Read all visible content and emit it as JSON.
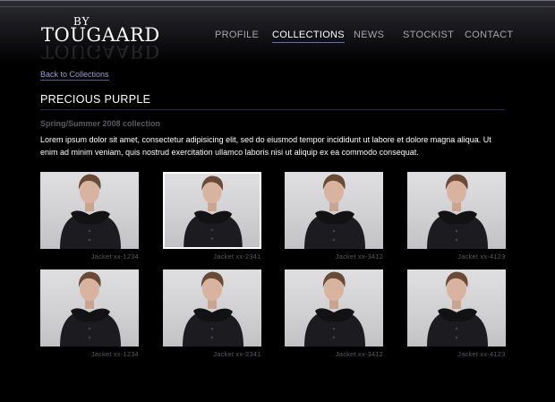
{
  "brand": {
    "by": "BY",
    "name": "TOUGAARD"
  },
  "nav": [
    {
      "label": "PROFILE",
      "active": false
    },
    {
      "label": "COLLECTIONS",
      "active": true
    },
    {
      "label": "NEWS",
      "active": false
    },
    {
      "label": "STOCKIST",
      "active": false
    },
    {
      "label": "CONTACT",
      "active": false
    }
  ],
  "back_link": "Back to Collections",
  "collection": {
    "title": "PRECIOUS PURPLE",
    "season": "Spring/Summer 2008 collection",
    "description": "Lorem ipsum dolor sit amet, consectetur adipisicing elit, sed do eiusmod tempor incididunt ut labore et dolore magna aliqua. Ut enim ad minim veniam, quis nostrud exercitation ullamco laboris nisi ut aliquip ex ea commodo consequat."
  },
  "items": [
    {
      "caption": "Jacket xx-1234",
      "selected": false
    },
    {
      "caption": "Jacket xx-2341",
      "selected": true
    },
    {
      "caption": "Jacket xx-3412",
      "selected": false
    },
    {
      "caption": "Jacket xx-4123",
      "selected": false
    },
    {
      "caption": "Jacket xx-1234",
      "selected": false
    },
    {
      "caption": "Jacket xx-2341",
      "selected": false
    },
    {
      "caption": "Jacket xx-3412",
      "selected": false
    },
    {
      "caption": "Jacket xx-4123",
      "selected": false
    }
  ],
  "colors": {
    "background": "#000000",
    "nav_active_underline": "#6c6cbf",
    "link": "#9c9cd8",
    "caption": "#58585f"
  }
}
